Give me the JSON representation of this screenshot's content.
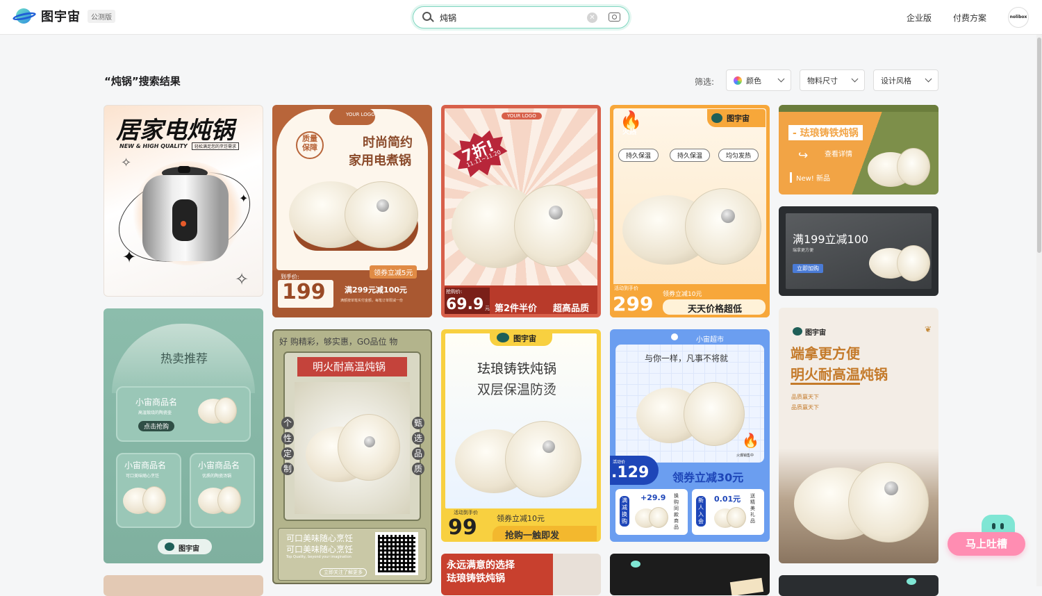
{
  "header": {
    "logo_text": "图宇宙",
    "beta_badge": "公测版",
    "search": {
      "value": "炖锅",
      "placeholder": "炖锅"
    },
    "nav": {
      "enterprise": "企业版",
      "pricing": "付费方案"
    },
    "avatar_text": "nolibox"
  },
  "results": {
    "title": "“炖锅”搜索结果",
    "filter_label": "筛选:",
    "filters": [
      "颜色",
      "物料尺寸",
      "设计风格"
    ]
  },
  "cards": {
    "c1": {
      "title": "居家电炖锅",
      "subtitle": "NEW & HIGH QUALITY",
      "tag": "轻松满足您的烹饪需求"
    },
    "c2": {
      "logo": "YOUR LOGO",
      "badge": "质量保障",
      "line1": "时尚简约",
      "line2": "家用电煮锅",
      "coupon": "领券立减5元",
      "price_label": "到手价:",
      "price": "199",
      "deal": "满299元减100元",
      "note": "满额按单笔实付金额，每笔订单限减一份"
    },
    "c3": {
      "logo": "YOUR LOGO",
      "discount": "7折!",
      "date": "11.11~11.20",
      "price_label": "抢购价:",
      "price": "69.9",
      "unit": "元",
      "deal": "第2件半价",
      "slogan": "超高品质"
    },
    "c4": {
      "logo": "图宇宙",
      "hot": "火热",
      "tags": [
        "持久保温",
        "持久保温",
        "均匀发热"
      ],
      "price_label": "活动到手价",
      "coupon": "领券立减10元",
      "price": "299",
      "slogan": "天天价格超低"
    },
    "c5": {
      "title": "- 珐琅铸铁炖锅",
      "link": "查看详情",
      "new": "New! 新品"
    },
    "c6": {
      "title": "满199立减100",
      "sub": "瑞拿更方便",
      "button": "立即加购"
    },
    "c7": {
      "title": "热卖推荐",
      "item_name": "小宙商品名",
      "item_desc": "高温锻烧的陶瓷壶",
      "buy": "点击抢购",
      "item2_desc": "可口美味随心烹饪",
      "item3_desc": "优质的陶瓷汤锅",
      "logo": "图宇宙"
    },
    "c8": {
      "banner": "好 购精彩，够实惠，GO品位 物",
      "title": "明火耐高温炖锅",
      "left_chars": [
        "个",
        "性",
        "定",
        "制"
      ],
      "right_chars": [
        "甄",
        "选",
        "品",
        "质"
      ],
      "line1": "可口美味随心烹饪",
      "line2": "可口美味随心烹饪",
      "small": "Top Quality, beyond your imagination",
      "follow": "立即关注了解更多"
    },
    "c9": {
      "logo": "图宇宙",
      "line1": "珐琅铸铁炖锅",
      "line2": "双层保温防烫",
      "price_label": "活动到手价",
      "price": "99",
      "coupon": "领券立减10元",
      "slogan": "抢购一触即发"
    },
    "c10": {
      "shop": "小宙超市",
      "headline": "与你一样，凡事不将就",
      "hot": "火爆销售中",
      "price_label": "活动价",
      "price": ".129",
      "coupon": "领券立减30元",
      "deal1_tag": "满减换购",
      "deal1_price": "+29.9",
      "deal1_desc": "换购同款商品",
      "deal2_tag": "新人入会",
      "deal2_price": "0.01元",
      "deal2_desc": "送精美礼品"
    },
    "c11": {
      "logo": "图宇宙",
      "line1": "端拿更方便",
      "line2": "明火耐高温炖锅",
      "desc1": "品质赢天下",
      "desc2": "品质赢天下"
    },
    "c12": {
      "line1": "永远满意的选择",
      "line2": "珐琅铸铁炖锅"
    }
  },
  "feedback": {
    "label": "马上吐槽"
  },
  "colors": {
    "accent": "#2fb89a",
    "brand": "#1f5fd6"
  }
}
